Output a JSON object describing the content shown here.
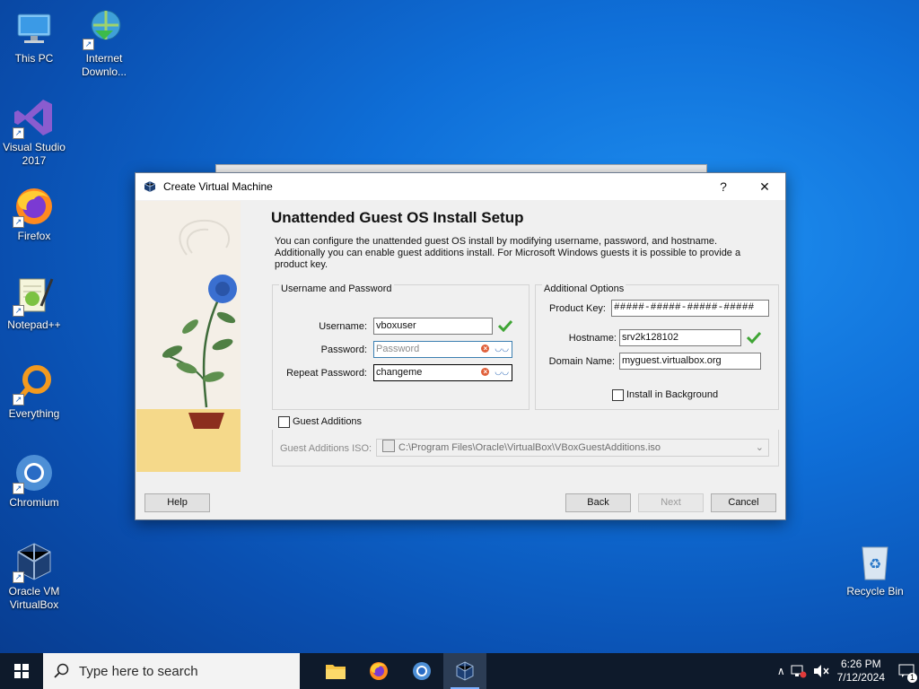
{
  "desktop": {
    "icons": [
      {
        "label": "This PC"
      },
      {
        "label": "Internet\nDownlo..."
      },
      {
        "label": "Visual Studio\n2017"
      },
      {
        "label": "Firefox"
      },
      {
        "label": "Notepad++"
      },
      {
        "label": "Everything"
      },
      {
        "label": "Chromium"
      },
      {
        "label": "Oracle VM\nVirtualBox"
      },
      {
        "label": "Recycle Bin"
      }
    ]
  },
  "dialog": {
    "title": "Create Virtual Machine",
    "help_glyph": "?",
    "close_glyph": "✕",
    "page_title": "Unattended Guest OS Install Setup",
    "intro": "You can configure the unattended guest OS install by modifying username, password, and hostname. Additionally you can enable guest additions install. For Microsoft Windows guests it is possible to provide a product key.",
    "user_group": {
      "title": "Username and Password",
      "username_label": "Username:",
      "username_value": "vboxuser",
      "password_label": "Password:",
      "password_placeholder": "Password",
      "repeat_label": "Repeat Password:",
      "repeat_value": "changeme"
    },
    "options_group": {
      "title": "Additional Options",
      "product_key_label": "Product Key:",
      "product_key_value": "#####-#####-#####-#####",
      "hostname_label": "Hostname:",
      "hostname_value": "srv2k128102",
      "domain_label": "Domain Name:",
      "domain_value": "myguest.virtualbox.org",
      "install_bg_label": "Install in Background",
      "install_bg_checked": false
    },
    "guest_additions": {
      "label": "Guest Additions",
      "checked": false,
      "iso_label": "Guest Additions ISO:",
      "iso_value": "C:\\Program Files\\Oracle\\VirtualBox\\VBoxGuestAdditions.iso"
    },
    "buttons": {
      "help": "Help",
      "back": "Back",
      "next": "Next",
      "cancel": "Cancel"
    }
  },
  "taskbar": {
    "search_placeholder": "Type here to search",
    "time": "6:26 PM",
    "date": "7/12/2024",
    "notification_count": "1"
  },
  "colors": {
    "accent": "#0f6fd8",
    "check_green": "#3fa535",
    "taskbar": "#0e1a2b"
  }
}
